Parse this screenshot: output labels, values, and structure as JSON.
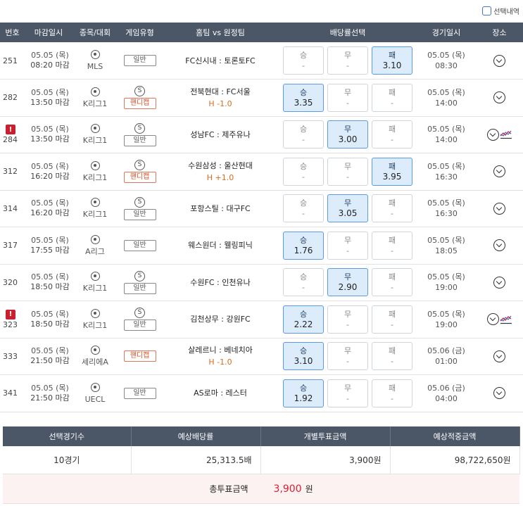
{
  "selection_history_label": "선택내역",
  "headers": [
    "번호",
    "마감일시",
    "종목/대회",
    "게임유형",
    "홈팀 vs 원정팀",
    "배당률선택",
    "경기일시",
    "장소"
  ],
  "rows": [
    {
      "no": "251",
      "alert": "",
      "deadline_date": "05.05 (목)",
      "deadline_time": "08:20 마감",
      "league": "MLS",
      "s_icon": "",
      "type": "일반",
      "handicap_type": false,
      "match": "FC신시내 : 토론토FC",
      "hc": "",
      "win_label": "승",
      "win": "-",
      "draw_label": "무",
      "draw": "-",
      "lose_label": "패",
      "lose": "3.10",
      "selected": "lose",
      "game_date": "05.05 (목)",
      "game_time": "08:30",
      "trend": false
    },
    {
      "no": "282",
      "alert": "",
      "deadline_date": "05.05 (목)",
      "deadline_time": "13:50 마감",
      "league": "K리그1",
      "s_icon": "S",
      "type": "핸디캡",
      "handicap_type": true,
      "match": "전북현대 : FC서울",
      "hc": "H -1.0",
      "win_label": "승",
      "win": "3.35",
      "draw_label": "무",
      "draw": "-",
      "lose_label": "패",
      "lose": "-",
      "selected": "win",
      "game_date": "05.05 (목)",
      "game_time": "14:00",
      "trend": false
    },
    {
      "no": "284",
      "alert": "!",
      "deadline_date": "05.05 (목)",
      "deadline_time": "13:50 마감",
      "league": "K리그1",
      "s_icon": "S",
      "type": "일반",
      "handicap_type": false,
      "match": "성남FC : 제주유나",
      "hc": "",
      "win_label": "승",
      "win": "-",
      "draw_label": "무",
      "draw": "3.00",
      "lose_label": "패",
      "lose": "-",
      "selected": "draw",
      "game_date": "05.05 (목)",
      "game_time": "14:00",
      "trend": true
    },
    {
      "no": "312",
      "alert": "",
      "deadline_date": "05.05 (목)",
      "deadline_time": "16:20 마감",
      "league": "K리그1",
      "s_icon": "S",
      "type": "핸디캡",
      "handicap_type": true,
      "match": "수원삼성 : 울산현대",
      "hc": "H +1.0",
      "win_label": "승",
      "win": "-",
      "draw_label": "무",
      "draw": "-",
      "lose_label": "패",
      "lose": "3.95",
      "selected": "lose",
      "game_date": "05.05 (목)",
      "game_time": "16:30",
      "trend": false
    },
    {
      "no": "314",
      "alert": "",
      "deadline_date": "05.05 (목)",
      "deadline_time": "16:20 마감",
      "league": "K리그1",
      "s_icon": "S",
      "type": "일반",
      "handicap_type": false,
      "match": "포항스틸 : 대구FC",
      "hc": "",
      "win_label": "승",
      "win": "-",
      "draw_label": "무",
      "draw": "3.05",
      "lose_label": "패",
      "lose": "-",
      "selected": "draw",
      "game_date": "05.05 (목)",
      "game_time": "16:30",
      "trend": false
    },
    {
      "no": "317",
      "alert": "",
      "deadline_date": "05.05 (목)",
      "deadline_time": "17:55 마감",
      "league": "A리그",
      "s_icon": "",
      "type": "일반",
      "handicap_type": false,
      "match": "웨스원더 : 웰링피닉",
      "hc": "",
      "win_label": "승",
      "win": "1.76",
      "draw_label": "무",
      "draw": "-",
      "lose_label": "패",
      "lose": "-",
      "selected": "win",
      "game_date": "05.05 (목)",
      "game_time": "18:05",
      "trend": false
    },
    {
      "no": "320",
      "alert": "",
      "deadline_date": "05.05 (목)",
      "deadline_time": "18:50 마감",
      "league": "K리그1",
      "s_icon": "S",
      "type": "일반",
      "handicap_type": false,
      "match": "수원FC : 인천유나",
      "hc": "",
      "win_label": "승",
      "win": "-",
      "draw_label": "무",
      "draw": "2.90",
      "lose_label": "패",
      "lose": "-",
      "selected": "draw",
      "game_date": "05.05 (목)",
      "game_time": "19:00",
      "trend": false
    },
    {
      "no": "323",
      "alert": "!",
      "deadline_date": "05.05 (목)",
      "deadline_time": "18:50 마감",
      "league": "K리그1",
      "s_icon": "S",
      "type": "일반",
      "handicap_type": false,
      "match": "김천상무 : 강원FC",
      "hc": "",
      "win_label": "승",
      "win": "2.22",
      "draw_label": "무",
      "draw": "-",
      "lose_label": "패",
      "lose": "-",
      "selected": "win",
      "game_date": "05.05 (목)",
      "game_time": "19:00",
      "trend": true
    },
    {
      "no": "333",
      "alert": "",
      "deadline_date": "05.05 (목)",
      "deadline_time": "21:50 마감",
      "league": "세리에A",
      "s_icon": "",
      "type": "핸디캡",
      "handicap_type": true,
      "match": "살레르니 : 베네치아",
      "hc": "H -1.0",
      "win_label": "승",
      "win": "3.10",
      "draw_label": "무",
      "draw": "-",
      "lose_label": "패",
      "lose": "-",
      "selected": "win",
      "game_date": "05.06 (금)",
      "game_time": "01:00",
      "trend": false
    },
    {
      "no": "341",
      "alert": "",
      "deadline_date": "05.05 (목)",
      "deadline_time": "21:50 마감",
      "league": "UECL",
      "s_icon": "",
      "type": "일반",
      "handicap_type": false,
      "match": "AS로마 : 레스터",
      "hc": "",
      "win_label": "승",
      "win": "1.92",
      "draw_label": "무",
      "draw": "-",
      "lose_label": "패",
      "lose": "-",
      "selected": "win",
      "game_date": "05.06 (금)",
      "game_time": "04:00",
      "trend": false
    }
  ],
  "summary": {
    "headers": [
      "선택경기수",
      "예상배당률",
      "개별투표금액",
      "예상적중금액"
    ],
    "values": [
      "10경기",
      "25,313.5배",
      "3,900원",
      "98,722,650원"
    ]
  },
  "total": {
    "label": "총투표금액",
    "amount": "3,900",
    "unit": "원"
  },
  "colors": {
    "header_bg": "#4b5667",
    "selected_bg": "#ddecfb",
    "selected_border": "#5a9be0",
    "accent_red": "#d8202f",
    "handicap_orange": "#d96b1c"
  }
}
